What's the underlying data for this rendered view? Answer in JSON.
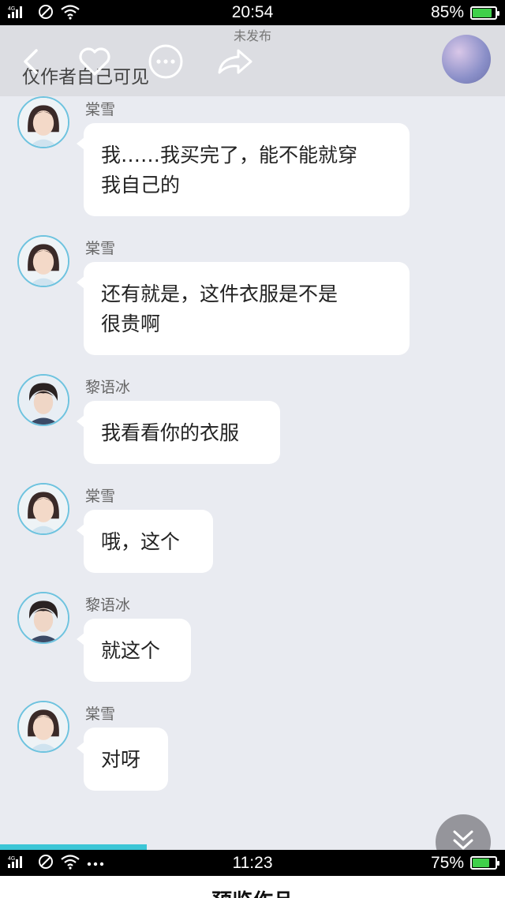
{
  "status_top": {
    "network": "4G",
    "time": "20:54",
    "battery": "85%",
    "battery_level": 0.85
  },
  "status_bottom": {
    "network": "4G",
    "time": "11:23",
    "battery": "75%",
    "battery_level": 0.75
  },
  "header": {
    "subtitle": "未发布",
    "privacy": "仅作者自己可见",
    "icons": [
      "back-icon",
      "heart-icon",
      "more-icon",
      "share-icon"
    ]
  },
  "messages": [
    {
      "sender": "棠雪",
      "avatar": "girl",
      "text": "我……我买完了，能不能就穿\n我自己的"
    },
    {
      "sender": "棠雪",
      "avatar": "girl",
      "text": "还有就是，这件衣服是不是\n很贵啊"
    },
    {
      "sender": "黎语冰",
      "avatar": "boy",
      "text": "我看看你的衣服"
    },
    {
      "sender": "棠雪",
      "avatar": "girl",
      "text": "哦，这个"
    },
    {
      "sender": "黎语冰",
      "avatar": "boy",
      "text": "就这个"
    },
    {
      "sender": "棠雪",
      "avatar": "girl",
      "text": "对呀"
    }
  ],
  "reading_progress": 0.29,
  "footer": {
    "title": "预览作品"
  },
  "colors": {
    "accent": "#3cc6d6",
    "avatar_ring": "#6ec3df",
    "background": "#e9ebf1"
  }
}
